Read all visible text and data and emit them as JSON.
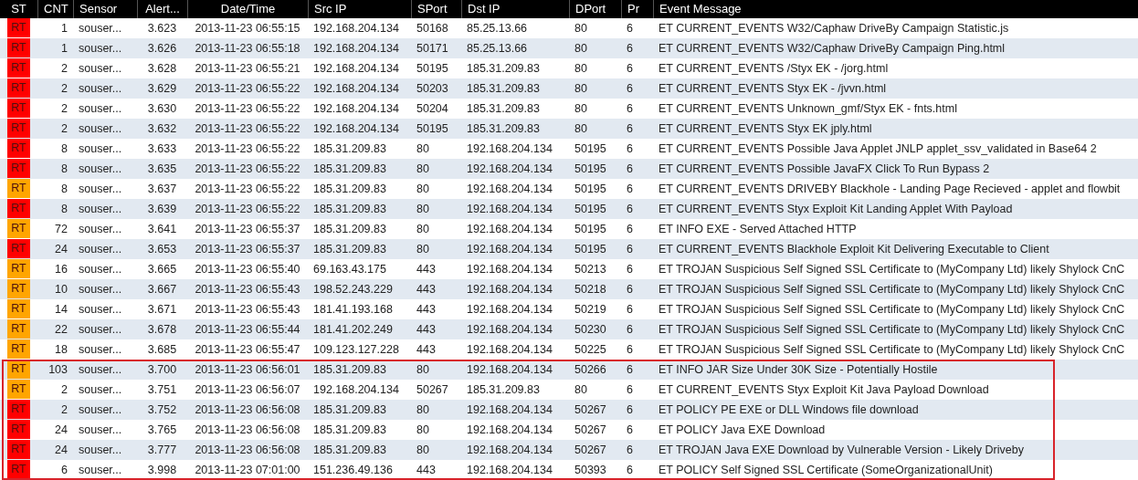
{
  "table": {
    "columns": [
      "ST",
      "CNT",
      "Sensor",
      "Alert...",
      "Date/Time",
      "Src IP",
      "SPort",
      "Dst IP",
      "DPort",
      "Pr",
      "Event Message"
    ],
    "rows": [
      {
        "st": "RT",
        "color": "#ff0000",
        "cnt": "1",
        "sensor": "souser...",
        "alert": "3.623",
        "datetime": "2013-11-23 06:55:15",
        "src_ip": "192.168.204.134",
        "sport": "50168",
        "dst_ip": "85.25.13.66",
        "dport": "80",
        "pr": "6",
        "message": "ET CURRENT_EVENTS W32/Caphaw DriveBy Campaign Statistic.js"
      },
      {
        "st": "RT",
        "color": "#ff0000",
        "cnt": "1",
        "sensor": "souser...",
        "alert": "3.626",
        "datetime": "2013-11-23 06:55:18",
        "src_ip": "192.168.204.134",
        "sport": "50171",
        "dst_ip": "85.25.13.66",
        "dport": "80",
        "pr": "6",
        "message": "ET CURRENT_EVENTS W32/Caphaw DriveBy Campaign Ping.html"
      },
      {
        "st": "RT",
        "color": "#ff0000",
        "cnt": "2",
        "sensor": "souser...",
        "alert": "3.628",
        "datetime": "2013-11-23 06:55:21",
        "src_ip": "192.168.204.134",
        "sport": "50195",
        "dst_ip": "185.31.209.83",
        "dport": "80",
        "pr": "6",
        "message": "ET CURRENT_EVENTS /Styx EK - /jorg.html"
      },
      {
        "st": "RT",
        "color": "#ff0000",
        "cnt": "2",
        "sensor": "souser...",
        "alert": "3.629",
        "datetime": "2013-11-23 06:55:22",
        "src_ip": "192.168.204.134",
        "sport": "50203",
        "dst_ip": "185.31.209.83",
        "dport": "80",
        "pr": "6",
        "message": "ET CURRENT_EVENTS Styx EK - /jvvn.html"
      },
      {
        "st": "RT",
        "color": "#ff0000",
        "cnt": "2",
        "sensor": "souser...",
        "alert": "3.630",
        "datetime": "2013-11-23 06:55:22",
        "src_ip": "192.168.204.134",
        "sport": "50204",
        "dst_ip": "185.31.209.83",
        "dport": "80",
        "pr": "6",
        "message": "ET CURRENT_EVENTS Unknown_gmf/Styx EK - fnts.html"
      },
      {
        "st": "RT",
        "color": "#ff0000",
        "cnt": "2",
        "sensor": "souser...",
        "alert": "3.632",
        "datetime": "2013-11-23 06:55:22",
        "src_ip": "192.168.204.134",
        "sport": "50195",
        "dst_ip": "185.31.209.83",
        "dport": "80",
        "pr": "6",
        "message": "ET CURRENT_EVENTS Styx EK jply.html"
      },
      {
        "st": "RT",
        "color": "#ff0000",
        "cnt": "8",
        "sensor": "souser...",
        "alert": "3.633",
        "datetime": "2013-11-23 06:55:22",
        "src_ip": "185.31.209.83",
        "sport": "80",
        "dst_ip": "192.168.204.134",
        "dport": "50195",
        "pr": "6",
        "message": "ET CURRENT_EVENTS Possible Java Applet JNLP applet_ssv_validated in Base64 2"
      },
      {
        "st": "RT",
        "color": "#ff0000",
        "cnt": "8",
        "sensor": "souser...",
        "alert": "3.635",
        "datetime": "2013-11-23 06:55:22",
        "src_ip": "185.31.209.83",
        "sport": "80",
        "dst_ip": "192.168.204.134",
        "dport": "50195",
        "pr": "6",
        "message": "ET CURRENT_EVENTS Possible JavaFX Click To Run Bypass 2"
      },
      {
        "st": "RT",
        "color": "#ffa500",
        "cnt": "8",
        "sensor": "souser...",
        "alert": "3.637",
        "datetime": "2013-11-23 06:55:22",
        "src_ip": "185.31.209.83",
        "sport": "80",
        "dst_ip": "192.168.204.134",
        "dport": "50195",
        "pr": "6",
        "message": "ET CURRENT_EVENTS DRIVEBY Blackhole - Landing Page Recieved - applet and flowbit"
      },
      {
        "st": "RT",
        "color": "#ff0000",
        "cnt": "8",
        "sensor": "souser...",
        "alert": "3.639",
        "datetime": "2013-11-23 06:55:22",
        "src_ip": "185.31.209.83",
        "sport": "80",
        "dst_ip": "192.168.204.134",
        "dport": "50195",
        "pr": "6",
        "message": "ET CURRENT_EVENTS Styx Exploit Kit Landing Applet With Payload"
      },
      {
        "st": "RT",
        "color": "#ffa500",
        "cnt": "72",
        "sensor": "souser...",
        "alert": "3.641",
        "datetime": "2013-11-23 06:55:37",
        "src_ip": "185.31.209.83",
        "sport": "80",
        "dst_ip": "192.168.204.134",
        "dport": "50195",
        "pr": "6",
        "message": "ET INFO EXE - Served Attached HTTP"
      },
      {
        "st": "RT",
        "color": "#ff0000",
        "cnt": "24",
        "sensor": "souser...",
        "alert": "3.653",
        "datetime": "2013-11-23 06:55:37",
        "src_ip": "185.31.209.83",
        "sport": "80",
        "dst_ip": "192.168.204.134",
        "dport": "50195",
        "pr": "6",
        "message": "ET CURRENT_EVENTS Blackhole Exploit Kit Delivering Executable to Client"
      },
      {
        "st": "RT",
        "color": "#ffa500",
        "cnt": "16",
        "sensor": "souser...",
        "alert": "3.665",
        "datetime": "2013-11-23 06:55:40",
        "src_ip": "69.163.43.175",
        "sport": "443",
        "dst_ip": "192.168.204.134",
        "dport": "50213",
        "pr": "6",
        "message": "ET TROJAN Suspicious Self Signed SSL Certificate to (MyCompany Ltd) likely Shylock CnC"
      },
      {
        "st": "RT",
        "color": "#ffa500",
        "cnt": "10",
        "sensor": "souser...",
        "alert": "3.667",
        "datetime": "2013-11-23 06:55:43",
        "src_ip": "198.52.243.229",
        "sport": "443",
        "dst_ip": "192.168.204.134",
        "dport": "50218",
        "pr": "6",
        "message": "ET TROJAN Suspicious Self Signed SSL Certificate to (MyCompany Ltd) likely Shylock CnC"
      },
      {
        "st": "RT",
        "color": "#ffa500",
        "cnt": "14",
        "sensor": "souser...",
        "alert": "3.671",
        "datetime": "2013-11-23 06:55:43",
        "src_ip": "181.41.193.168",
        "sport": "443",
        "dst_ip": "192.168.204.134",
        "dport": "50219",
        "pr": "6",
        "message": "ET TROJAN Suspicious Self Signed SSL Certificate to (MyCompany Ltd) likely Shylock CnC"
      },
      {
        "st": "RT",
        "color": "#ffa500",
        "cnt": "22",
        "sensor": "souser...",
        "alert": "3.678",
        "datetime": "2013-11-23 06:55:44",
        "src_ip": "181.41.202.249",
        "sport": "443",
        "dst_ip": "192.168.204.134",
        "dport": "50230",
        "pr": "6",
        "message": "ET TROJAN Suspicious Self Signed SSL Certificate to (MyCompany Ltd) likely Shylock CnC"
      },
      {
        "st": "RT",
        "color": "#ffa500",
        "cnt": "18",
        "sensor": "souser...",
        "alert": "3.685",
        "datetime": "2013-11-23 06:55:47",
        "src_ip": "109.123.127.228",
        "sport": "443",
        "dst_ip": "192.168.204.134",
        "dport": "50225",
        "pr": "6",
        "message": "ET TROJAN Suspicious Self Signed SSL Certificate to (MyCompany Ltd) likely Shylock CnC"
      }
    ],
    "highlighted_rows": [
      {
        "st": "RT",
        "color": "#ffa500",
        "cnt": "103",
        "sensor": "souser...",
        "alert": "3.700",
        "datetime": "2013-11-23 06:56:01",
        "src_ip": "185.31.209.83",
        "sport": "80",
        "dst_ip": "192.168.204.134",
        "dport": "50266",
        "pr": "6",
        "message": "ET INFO JAR Size Under 30K Size - Potentially Hostile"
      },
      {
        "st": "RT",
        "color": "#ffa500",
        "cnt": "2",
        "sensor": "souser...",
        "alert": "3.751",
        "datetime": "2013-11-23 06:56:07",
        "src_ip": "192.168.204.134",
        "sport": "50267",
        "dst_ip": "185.31.209.83",
        "dport": "80",
        "pr": "6",
        "message": "ET CURRENT_EVENTS Styx Exploit Kit Java Payload Download"
      },
      {
        "st": "RT",
        "color": "#ff0000",
        "cnt": "2",
        "sensor": "souser...",
        "alert": "3.752",
        "datetime": "2013-11-23 06:56:08",
        "src_ip": "185.31.209.83",
        "sport": "80",
        "dst_ip": "192.168.204.134",
        "dport": "50267",
        "pr": "6",
        "message": "ET POLICY PE EXE or DLL Windows file download"
      },
      {
        "st": "RT",
        "color": "#ff0000",
        "cnt": "24",
        "sensor": "souser...",
        "alert": "3.765",
        "datetime": "2013-11-23 06:56:08",
        "src_ip": "185.31.209.83",
        "sport": "80",
        "dst_ip": "192.168.204.134",
        "dport": "50267",
        "pr": "6",
        "message": "ET POLICY Java EXE Download"
      },
      {
        "st": "RT",
        "color": "#ff0000",
        "cnt": "24",
        "sensor": "souser...",
        "alert": "3.777",
        "datetime": "2013-11-23 06:56:08",
        "src_ip": "185.31.209.83",
        "sport": "80",
        "dst_ip": "192.168.204.134",
        "dport": "50267",
        "pr": "6",
        "message": "ET TROJAN Java EXE Download by Vulnerable Version - Likely Driveby"
      },
      {
        "st": "RT",
        "color": "#ff0000",
        "cnt": "6",
        "sensor": "souser...",
        "alert": "3.998",
        "datetime": "2013-11-23 07:01:00",
        "src_ip": "151.236.49.136",
        "sport": "443",
        "dst_ip": "192.168.204.134",
        "dport": "50393",
        "pr": "6",
        "message": "ET POLICY Self Signed SSL Certificate (SomeOrganizationalUnit)"
      }
    ]
  }
}
